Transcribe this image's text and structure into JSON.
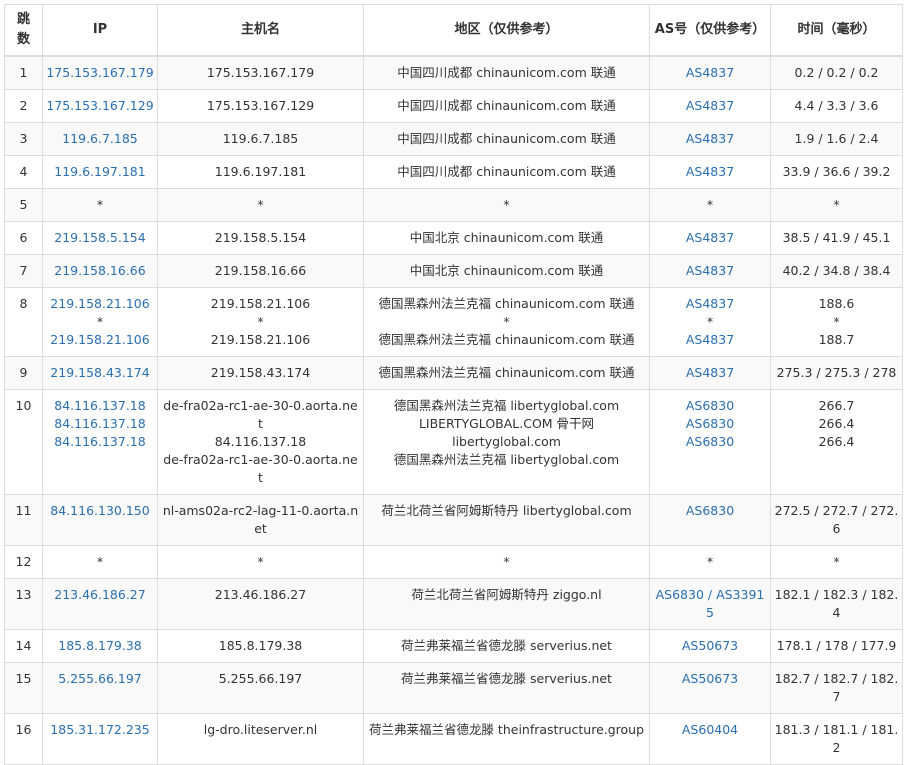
{
  "headers": {
    "hop": "跳数",
    "ip": "IP",
    "host": "主机名",
    "region": "地区（仅供参考）",
    "as": "AS号（仅供参考）",
    "time": "时间（毫秒）"
  },
  "rows": [
    {
      "hop": "1",
      "ip": [
        "175.153.167.179"
      ],
      "host": [
        "175.153.167.179"
      ],
      "region": [
        "中国四川成都 chinaunicom.com 联通"
      ],
      "as": [
        "AS4837"
      ],
      "time": [
        "0.2 / 0.2 / 0.2"
      ]
    },
    {
      "hop": "2",
      "ip": [
        "175.153.167.129"
      ],
      "host": [
        "175.153.167.129"
      ],
      "region": [
        "中国四川成都 chinaunicom.com 联通"
      ],
      "as": [
        "AS4837"
      ],
      "time": [
        "4.4 / 3.3 / 3.6"
      ]
    },
    {
      "hop": "3",
      "ip": [
        "119.6.7.185"
      ],
      "host": [
        "119.6.7.185"
      ],
      "region": [
        "中国四川成都 chinaunicom.com 联通"
      ],
      "as": [
        "AS4837"
      ],
      "time": [
        "1.9 / 1.6 / 2.4"
      ]
    },
    {
      "hop": "4",
      "ip": [
        "119.6.197.181"
      ],
      "host": [
        "119.6.197.181"
      ],
      "region": [
        "中国四川成都 chinaunicom.com 联通"
      ],
      "as": [
        "AS4837"
      ],
      "time": [
        "33.9 / 36.6 / 39.2"
      ]
    },
    {
      "hop": "5",
      "ip": [
        "*"
      ],
      "host": [
        "*"
      ],
      "region": [
        "*"
      ],
      "as": [
        "*"
      ],
      "time": [
        "*"
      ]
    },
    {
      "hop": "6",
      "ip": [
        "219.158.5.154"
      ],
      "host": [
        "219.158.5.154"
      ],
      "region": [
        "中国北京 chinaunicom.com 联通"
      ],
      "as": [
        "AS4837"
      ],
      "time": [
        "38.5 / 41.9 / 45.1"
      ]
    },
    {
      "hop": "7",
      "ip": [
        "219.158.16.66"
      ],
      "host": [
        "219.158.16.66"
      ],
      "region": [
        "中国北京 chinaunicom.com 联通"
      ],
      "as": [
        "AS4837"
      ],
      "time": [
        "40.2 / 34.8 / 38.4"
      ]
    },
    {
      "hop": "8",
      "ip": [
        "219.158.21.106",
        "*",
        "219.158.21.106"
      ],
      "host": [
        "219.158.21.106",
        "*",
        "219.158.21.106"
      ],
      "region": [
        "德国黑森州法兰克福 chinaunicom.com 联通",
        "*",
        "德国黑森州法兰克福 chinaunicom.com 联通"
      ],
      "as": [
        "AS4837",
        "*",
        "AS4837"
      ],
      "time": [
        "188.6",
        "*",
        "188.7"
      ]
    },
    {
      "hop": "9",
      "ip": [
        "219.158.43.174"
      ],
      "host": [
        "219.158.43.174"
      ],
      "region": [
        "德国黑森州法兰克福 chinaunicom.com 联通"
      ],
      "as": [
        "AS4837"
      ],
      "time": [
        "275.3 / 275.3 / 278"
      ]
    },
    {
      "hop": "10",
      "ip": [
        "84.116.137.18",
        "84.116.137.18",
        "84.116.137.18"
      ],
      "host": [
        "de-fra02a-rc1-ae-30-0.aorta.net",
        "84.116.137.18",
        "de-fra02a-rc1-ae-30-0.aorta.net"
      ],
      "region": [
        "德国黑森州法兰克福 libertyglobal.com",
        "LIBERTYGLOBAL.COM 骨干网",
        "libertyglobal.com",
        "德国黑森州法兰克福 libertyglobal.com"
      ],
      "as": [
        "AS6830",
        "AS6830",
        "AS6830"
      ],
      "time": [
        "266.7",
        "266.4",
        "266.4"
      ]
    },
    {
      "hop": "11",
      "ip": [
        "84.116.130.150"
      ],
      "host": [
        "nl-ams02a-rc2-lag-11-0.aorta.net"
      ],
      "region": [
        "荷兰北荷兰省阿姆斯特丹 libertyglobal.com"
      ],
      "as": [
        "AS6830"
      ],
      "time": [
        "272.5 / 272.7 / 272.6"
      ]
    },
    {
      "hop": "12",
      "ip": [
        "*"
      ],
      "host": [
        "*"
      ],
      "region": [
        "*"
      ],
      "as": [
        "*"
      ],
      "time": [
        "*"
      ]
    },
    {
      "hop": "13",
      "ip": [
        "213.46.186.27"
      ],
      "host": [
        "213.46.186.27"
      ],
      "region": [
        "荷兰北荷兰省阿姆斯特丹 ziggo.nl"
      ],
      "as": [
        "AS6830 / AS33915"
      ],
      "time": [
        "182.1 / 182.3 / 182.4"
      ]
    },
    {
      "hop": "14",
      "ip": [
        "185.8.179.38"
      ],
      "host": [
        "185.8.179.38"
      ],
      "region": [
        "荷兰弗莱福兰省德龙滕 serverius.net"
      ],
      "as": [
        "AS50673"
      ],
      "time": [
        "178.1 / 178 / 177.9"
      ]
    },
    {
      "hop": "15",
      "ip": [
        "5.255.66.197"
      ],
      "host": [
        "5.255.66.197"
      ],
      "region": [
        "荷兰弗莱福兰省德龙滕 serverius.net"
      ],
      "as": [
        "AS50673"
      ],
      "time": [
        "182.7 / 182.7 / 182.7"
      ]
    },
    {
      "hop": "16",
      "ip": [
        "185.31.172.235"
      ],
      "host": [
        "lg-dro.liteserver.nl"
      ],
      "region": [
        "荷兰弗莱福兰省德龙滕 theinfrastructure.group"
      ],
      "as": [
        "AS60404"
      ],
      "time": [
        "181.3 / 181.1 / 181.2"
      ]
    }
  ],
  "colors": {
    "link": "#2a6fb0",
    "text": "#333333",
    "border": "#dddddd",
    "stripe": "#f9f9f9"
  }
}
